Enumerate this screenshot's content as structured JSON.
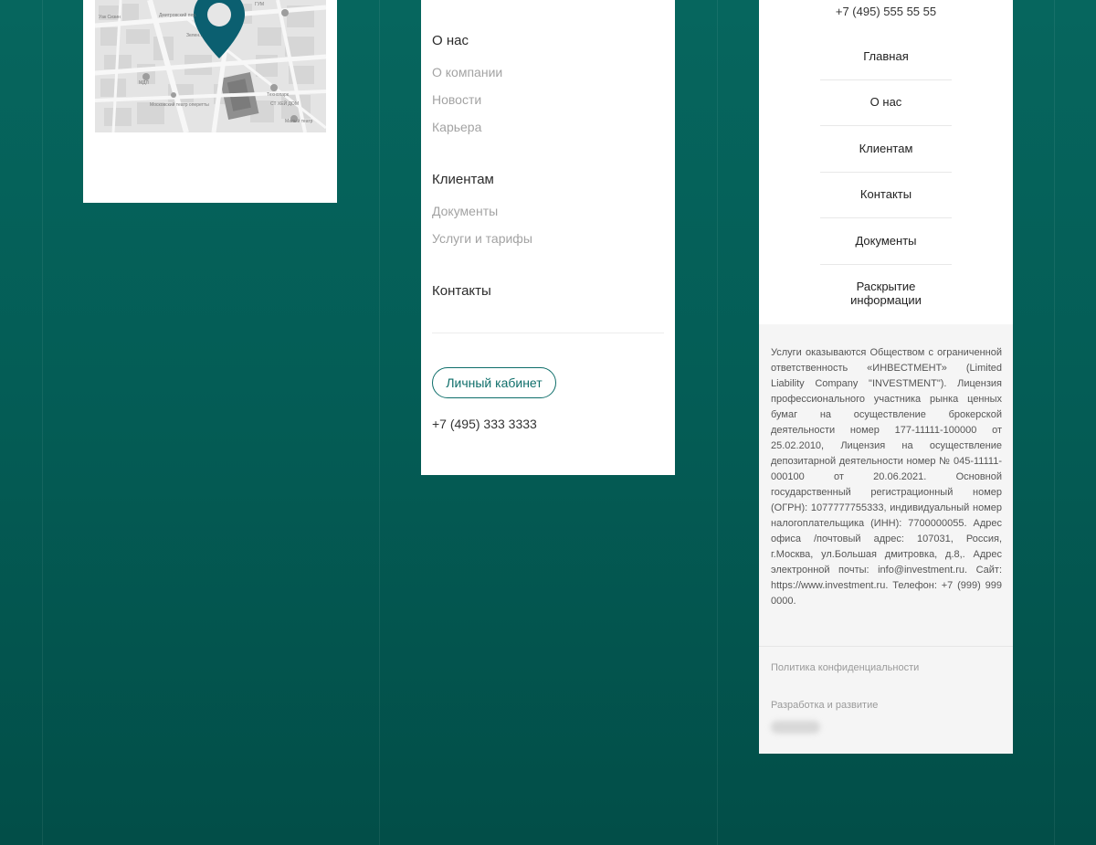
{
  "map": {
    "labels": [
      "Уак Сизин",
      "Дмитровский пер.",
      "Зелен...",
      "МДЛ",
      "Московский театр оперетты",
      "ГУМ",
      "Технопарк",
      "Малый театр",
      "СТ ХЕЙ ДОМ"
    ]
  },
  "menu": {
    "sections": [
      {
        "title": "О нас",
        "links": [
          "О компании",
          "Новости",
          "Карьера"
        ]
      },
      {
        "title": "Клиентам",
        "links": [
          "Документы",
          "Услуги и тарифы"
        ]
      },
      {
        "title": "Контакты",
        "links": []
      }
    ],
    "cabinet_label": "Личный кабинет",
    "phone": "+7 (495) 333 3333"
  },
  "footer": {
    "phone": "+7 (495) 555 55 55",
    "nav": [
      "Главная",
      "О нас",
      "Клиентам",
      "Контакты",
      "Документы",
      "Раскрытие информации"
    ],
    "legal": "Услуги оказываются Обществом с ограниченной ответственность «ИНВЕСТМЕНТ» (Limited Liability Company \"INVESTMENT\"). Лицензия профессионального участника рынка ценных бумаг на осуществление брокерской деятельности номер 177-11111-100000 от 25.02.2010, Лицензия на осуществление депозитарной деятельности номер № 045-11111-000100 от 20.06.2021. Основной государственный регистрационный номер (ОГРН): 1077777755333, индивидуальный номер налогоплательщика (ИНН): 7700000055. Адрес офиса /почтовый адрес: 107031, Россия, г.Москва, ул.Большая дмитровка, д.8,. Адрес электронной почты: info@investment.ru. Сайт: https://www.investment.ru. Телефон: +7 (999) 999 0000.",
    "policy": "Политика конфиденциальности",
    "dev_label": "Разработка и развитие"
  },
  "colors": {
    "background": "#045c55",
    "accent": "#0e6e6a",
    "map_pin": "#0b5f70"
  }
}
